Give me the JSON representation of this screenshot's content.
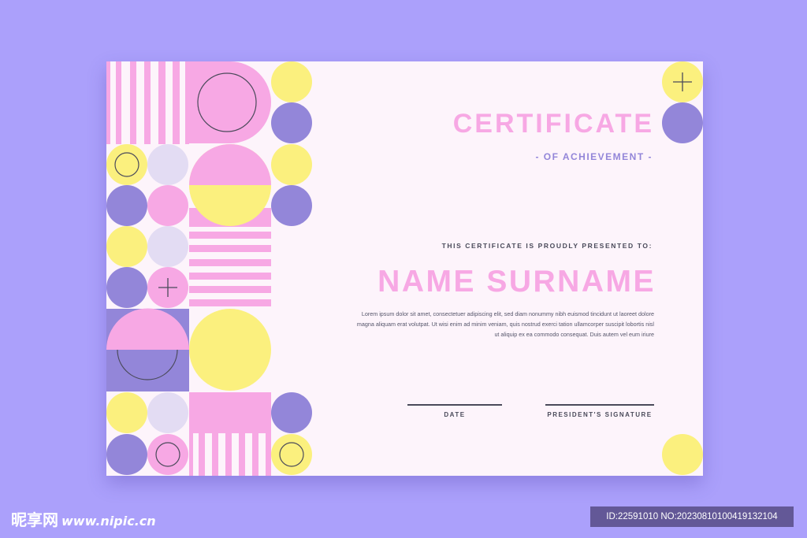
{
  "certificate": {
    "title": "CERTIFICATE",
    "subtitle": "- OF ACHIEVEMENT -",
    "presented_to": "THIS CERTIFICATE IS PROUDLY PRESENTED TO:",
    "recipient_name": "NAME SURNAME",
    "body_lines": [
      "Lorem ipsum dolor sit amet, consectetuer adipiscing elit, sed diam nonummy nibh euismod tincidunt ut laoreet dolore",
      "magna aliquam erat volutpat. Ut wisi enim ad minim veniam, quis nostrud exerci tation ullamcorper suscipit lobortis nisl",
      "ut aliquip ex ea commodo consequat. Duis autem vel eum iriure"
    ],
    "date_label": "DATE",
    "signature_label": "PRESIDENT'S SIGNATURE"
  },
  "watermark": {
    "logo": "昵享网",
    "url": "www.nipic.cn",
    "id_text": "ID:22591010 NO:20230810100419132104"
  },
  "colors": {
    "background": "#aba0fb",
    "card": "#fdf4fb",
    "pink": "#f7a8e4",
    "yellow": "#fbf07e",
    "purple": "#9386d9",
    "lavender": "#e3dcf3",
    "text": "#4a4a5a"
  },
  "icons": [
    "plus-icon",
    "circle-outline-icon"
  ]
}
